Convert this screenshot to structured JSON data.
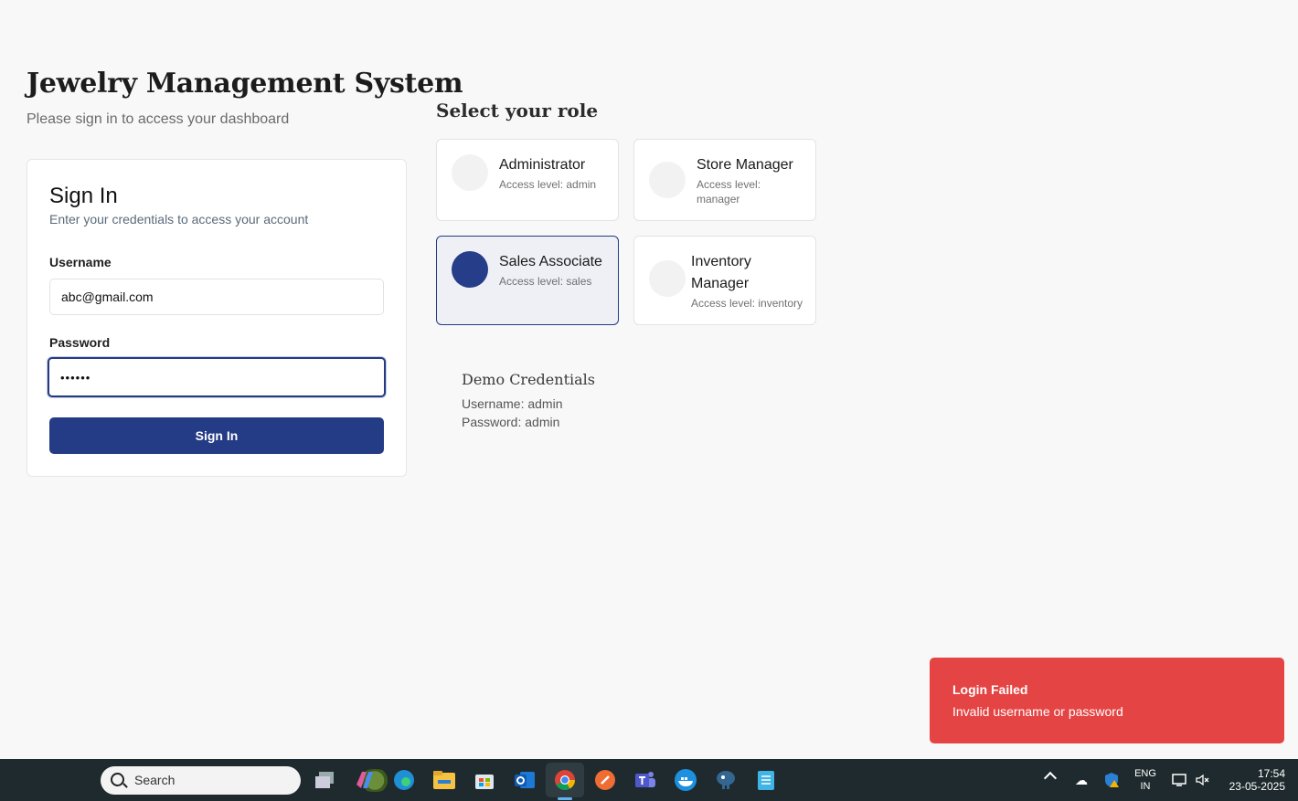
{
  "header": {
    "title": "Jewelry Management System",
    "subtitle": "Please sign in to access your dashboard"
  },
  "signin": {
    "title": "Sign In",
    "description": "Enter your credentials to access your account",
    "username_label": "Username",
    "username_value": "abc@gmail.com",
    "password_label": "Password",
    "password_value": "••••••",
    "button_label": "Sign In"
  },
  "roles": {
    "heading": "Select your role",
    "items": [
      {
        "name": "Administrator",
        "access": "Access level: admin",
        "selected": false
      },
      {
        "name": "Store Manager",
        "access": "Access level: manager",
        "selected": false
      },
      {
        "name": "Sales Associate",
        "access": "Access level: sales",
        "selected": true
      },
      {
        "name": "Inventory Manager",
        "access": "Access level: inventory",
        "selected": false
      }
    ]
  },
  "demo": {
    "title": "Demo Credentials",
    "username_line": "Username: admin",
    "password_line": "Password: admin"
  },
  "toast": {
    "title": "Login Failed",
    "message": "Invalid username or password",
    "color": "#e54444"
  },
  "taskbar": {
    "search_label": "Search",
    "apps": [
      "task-view-icon",
      "copilot-icon",
      "edge-icon",
      "file-explorer-icon",
      "store-icon",
      "outlook-icon",
      "chrome-icon",
      "postman-icon",
      "teams-icon",
      "docker-icon",
      "pgadmin-icon",
      "notepad-icon"
    ],
    "active_app": "chrome-icon",
    "lang_line1": "ENG",
    "lang_line2": "IN",
    "time": "17:54",
    "date": "23-05-2025"
  },
  "colors": {
    "primary": "#243b86",
    "selected_card_bg": "#eff0f5",
    "background": "#f8f8f8"
  }
}
